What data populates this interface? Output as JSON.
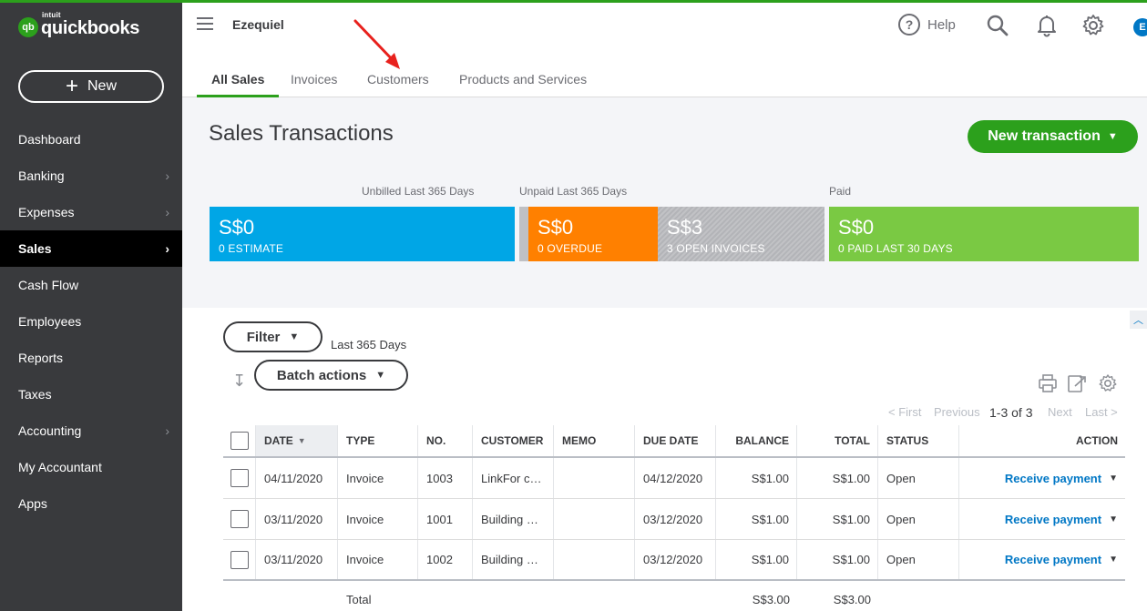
{
  "brand": {
    "mark": "qb",
    "intuit": "intuit",
    "name": "quickbooks"
  },
  "sidebar": {
    "new_label": "New",
    "items": [
      {
        "label": "Dashboard",
        "chevron": false,
        "active": false
      },
      {
        "label": "Banking",
        "chevron": true,
        "active": false
      },
      {
        "label": "Expenses",
        "chevron": true,
        "active": false
      },
      {
        "label": "Sales",
        "chevron": true,
        "active": true
      },
      {
        "label": "Cash Flow",
        "chevron": false,
        "active": false
      },
      {
        "label": "Employees",
        "chevron": false,
        "active": false
      },
      {
        "label": "Reports",
        "chevron": false,
        "active": false
      },
      {
        "label": "Taxes",
        "chevron": false,
        "active": false
      },
      {
        "label": "Accounting",
        "chevron": true,
        "active": false
      },
      {
        "label": "My Accountant",
        "chevron": false,
        "active": false
      },
      {
        "label": "Apps",
        "chevron": false,
        "active": false
      }
    ]
  },
  "header": {
    "company": "Ezequiel",
    "help_label": "Help",
    "avatar_initial": "E"
  },
  "tabs": [
    {
      "label": "All Sales",
      "active": true
    },
    {
      "label": "Invoices",
      "active": false
    },
    {
      "label": "Customers",
      "active": false
    },
    {
      "label": "Products and Services",
      "active": false
    }
  ],
  "page": {
    "title": "Sales Transactions",
    "new_transaction_label": "New transaction"
  },
  "money_bar": {
    "unbilled_label": "Unbilled Last 365 Days",
    "unpaid_label": "Unpaid Last 365 Days",
    "paid_label": "Paid",
    "estimate": {
      "amount": "S$0",
      "caption": "0 ESTIMATE"
    },
    "overdue": {
      "amount": "S$0",
      "caption": "0 OVERDUE"
    },
    "open": {
      "amount": "S$3",
      "caption": "3 OPEN INVOICES"
    },
    "paid": {
      "amount": "S$0",
      "caption": "0 PAID LAST 30 DAYS"
    }
  },
  "filters": {
    "filter_label": "Filter",
    "range_label": "Last 365 Days",
    "batch_label": "Batch actions"
  },
  "pager": {
    "first": "< First",
    "previous": "Previous",
    "count": "1-3 of 3",
    "next": "Next",
    "last": "Last >"
  },
  "table": {
    "columns": [
      "DATE",
      "TYPE",
      "NO.",
      "CUSTOMER",
      "MEMO",
      "DUE DATE",
      "BALANCE",
      "TOTAL",
      "STATUS",
      "ACTION"
    ],
    "rows": [
      {
        "date": "04/11/2020",
        "type": "Invoice",
        "no": "1003",
        "customer": "LinkFor c…",
        "memo": "",
        "due": "04/12/2020",
        "balance": "S$1.00",
        "total": "S$1.00",
        "status": "Open",
        "action": "Receive payment"
      },
      {
        "date": "03/11/2020",
        "type": "Invoice",
        "no": "1001",
        "customer": "Building …",
        "memo": "",
        "due": "03/12/2020",
        "balance": "S$1.00",
        "total": "S$1.00",
        "status": "Open",
        "action": "Receive payment"
      },
      {
        "date": "03/11/2020",
        "type": "Invoice",
        "no": "1002",
        "customer": "Building …",
        "memo": "",
        "due": "03/12/2020",
        "balance": "S$1.00",
        "total": "S$1.00",
        "status": "Open",
        "action": "Receive payment"
      }
    ],
    "total_row": {
      "label": "Total",
      "balance": "S$3.00",
      "total": "S$3.00"
    }
  },
  "colors": {
    "brand_green": "#2ca01c",
    "sidebar_bg": "#393a3d",
    "unbilled_blue": "#00a6e6",
    "overdue_orange": "#ff8000",
    "paid_green": "#7ac943",
    "link_blue": "#0077c5",
    "annotation_red": "#e8211d"
  }
}
